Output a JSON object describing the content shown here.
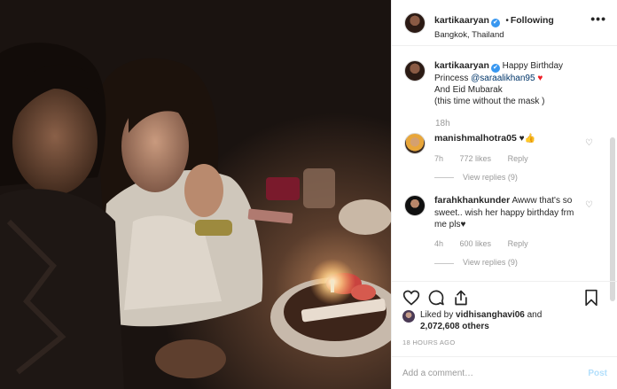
{
  "post": {
    "username": "kartikaaryan",
    "follow_state": "Following",
    "location": "Bangkok, Thailand",
    "verified_mark": "✔",
    "dot": "•",
    "more_icon": "•••"
  },
  "caption": {
    "username": "kartikaaryan",
    "text_1": "Happy Birthday Princess",
    "mention": "@saraalikhan95",
    "emoji": "♥",
    "text_2": "And Eid Mubarak",
    "text_3": "(this time without the mask )",
    "time": "18h"
  },
  "comments": [
    {
      "username": "manishmalhotra05",
      "text": "♥👍",
      "time": "7h",
      "likes": "772 likes",
      "reply_label": "Reply",
      "view_replies": "View replies (9)"
    },
    {
      "username": "farahkhankunder",
      "text": "Awww that's so sweet.. wish her happy birthday frm me pls♥",
      "time": "4h",
      "likes": "600 likes",
      "reply_label": "Reply",
      "view_replies": "View replies (9)"
    }
  ],
  "likes": {
    "prefix": "Liked by",
    "user": "vidhisanghavi06",
    "and": "and",
    "count": "2,072,608 others"
  },
  "post_time": "18 HOURS AGO",
  "add_comment": {
    "placeholder": "Add a comment…",
    "post_label": "Post"
  },
  "colors": {
    "accent": "#3897f0",
    "heart": "#ed1c24",
    "post_disabled": "#b2dffc"
  }
}
